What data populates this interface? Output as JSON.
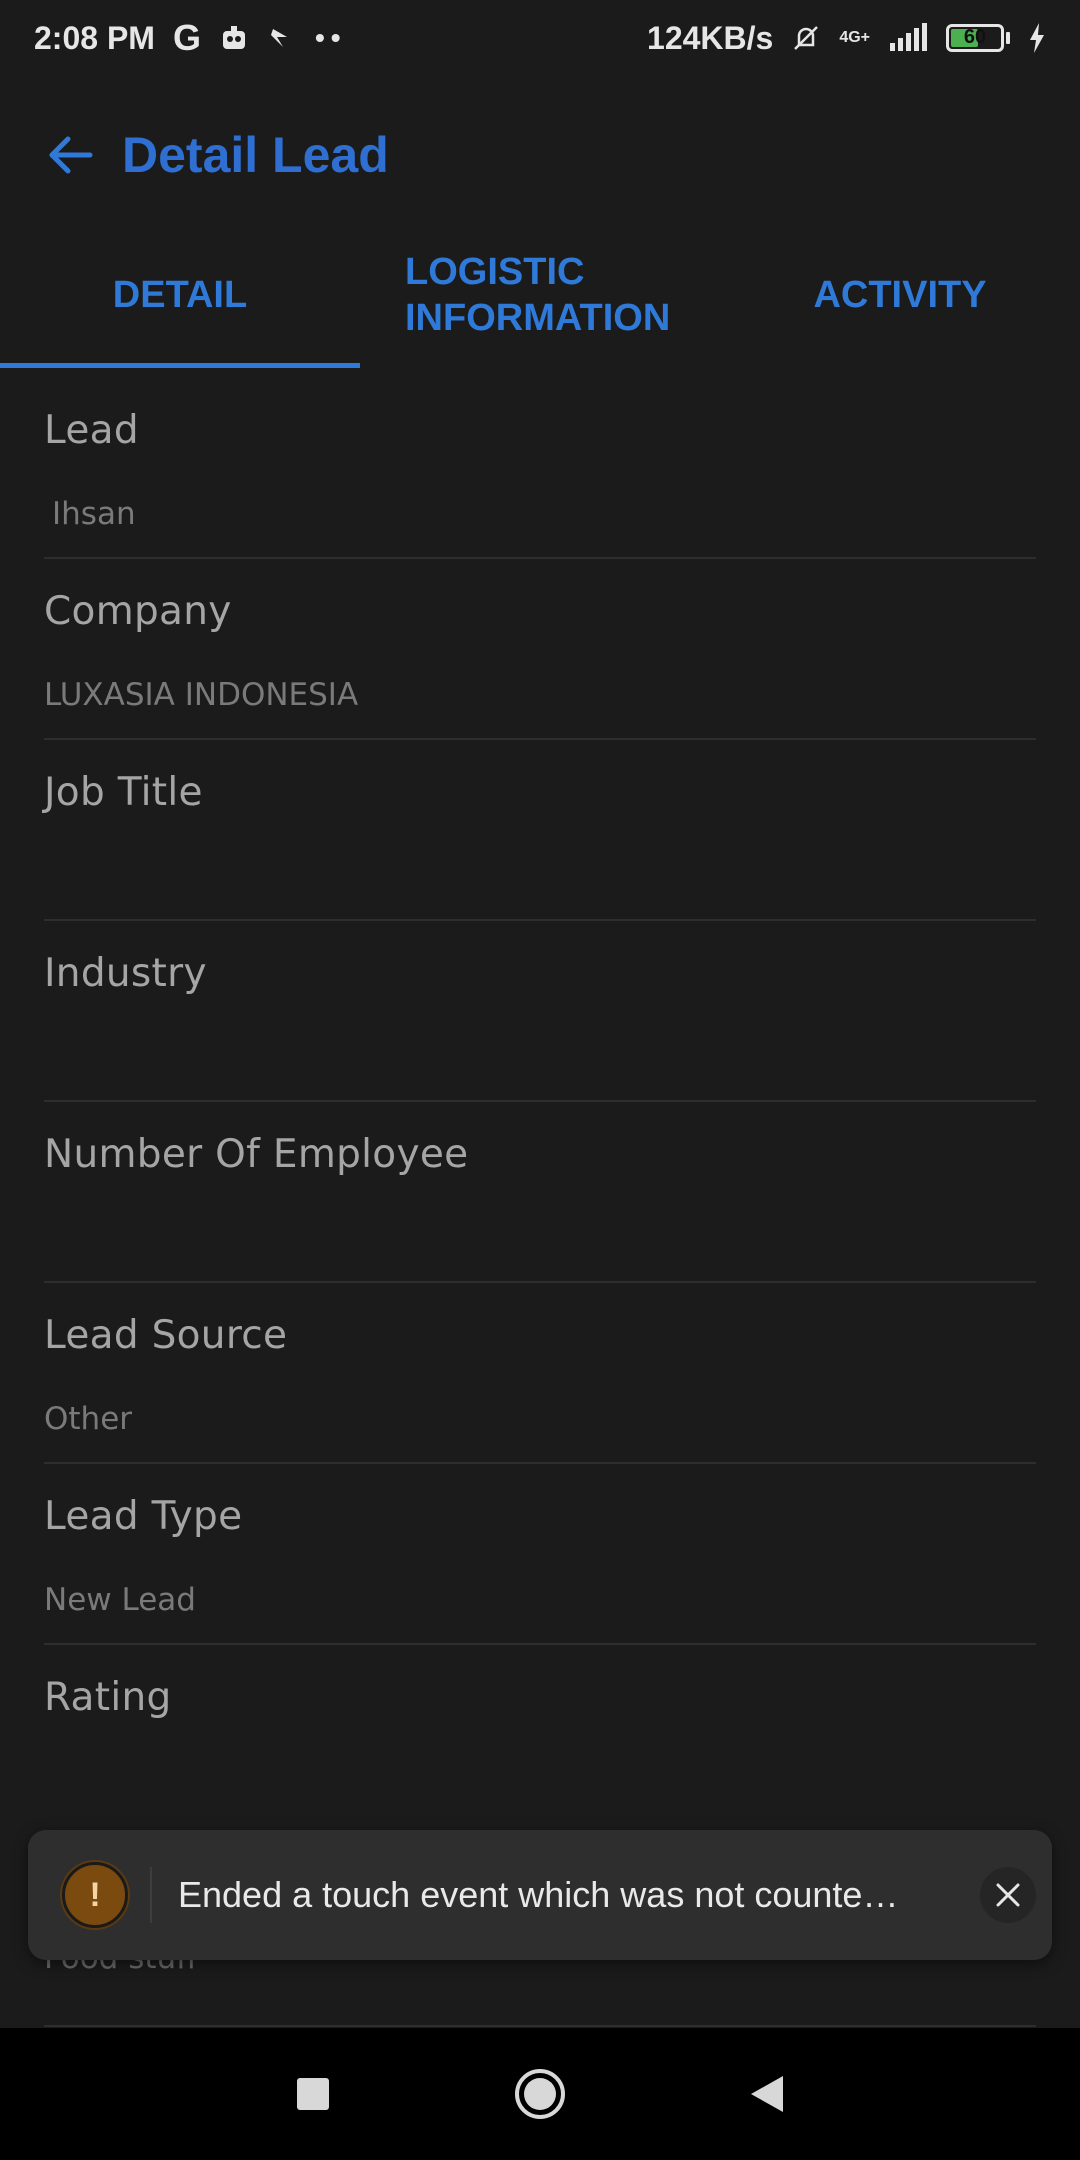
{
  "status_bar": {
    "time": "2:08 PM",
    "g_label": "G",
    "more_dots": "••",
    "speed": "124KB/s",
    "network": "4G+",
    "battery": "60",
    "battery_level": 0.6
  },
  "header": {
    "title": "Detail Lead"
  },
  "tabs": [
    {
      "label": "DETAIL",
      "active": true
    },
    {
      "label": "LOGISTIC INFORMATION",
      "active": false
    },
    {
      "label": "ACTIVITY",
      "active": false
    }
  ],
  "fields": [
    {
      "label": "Lead",
      "value": "Ihsan"
    },
    {
      "label": "Company",
      "value": "LUXASIA INDONESIA"
    },
    {
      "label": "Job Title",
      "value": ""
    },
    {
      "label": "Industry",
      "value": ""
    },
    {
      "label": "Number Of Employee",
      "value": ""
    },
    {
      "label": "Lead Source",
      "value": "Other"
    },
    {
      "label": "Lead Type",
      "value": "New Lead"
    },
    {
      "label": "Rating",
      "value": ""
    }
  ],
  "partially_hidden_value": "Food stuff",
  "toast": {
    "message": "Ended a touch event which was not counte…",
    "icon": "!"
  },
  "colors": {
    "accent": "#2f7ad9",
    "background": "#1b1b1b",
    "toast_bg": "#2e2e2e",
    "warning": "#7a4a0f"
  }
}
